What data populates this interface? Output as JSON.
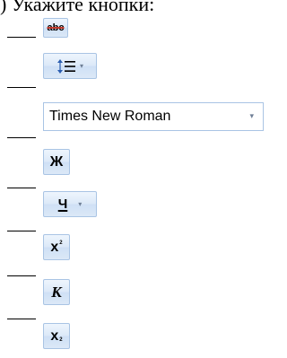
{
  "heading": {
    "text": ") Укажите кнопки:"
  },
  "toolbar": {
    "strikethrough": {
      "icon": "strikethrough-icon",
      "glyph": "abc"
    },
    "line_spacing": {
      "icon": "line-spacing-icon",
      "arrow": "▾"
    },
    "font_name": {
      "value": "Times New Roman",
      "arrow": "▾"
    },
    "bold": {
      "icon": "bold-icon",
      "glyph": "Ж"
    },
    "underline": {
      "icon": "underline-icon",
      "glyph": "Ч",
      "arrow": "▾"
    },
    "superscript": {
      "icon": "superscript-icon",
      "glyph": "x",
      "sup": "2"
    },
    "italic": {
      "icon": "italic-icon",
      "glyph": "К"
    },
    "subscript": {
      "icon": "subscript-icon",
      "glyph": "x",
      "sub": "2"
    }
  },
  "colors": {
    "button_border": "#a9c4e4",
    "button_fill": "#dce9f8",
    "spacing_arrow_blue": "#2a5db0"
  }
}
